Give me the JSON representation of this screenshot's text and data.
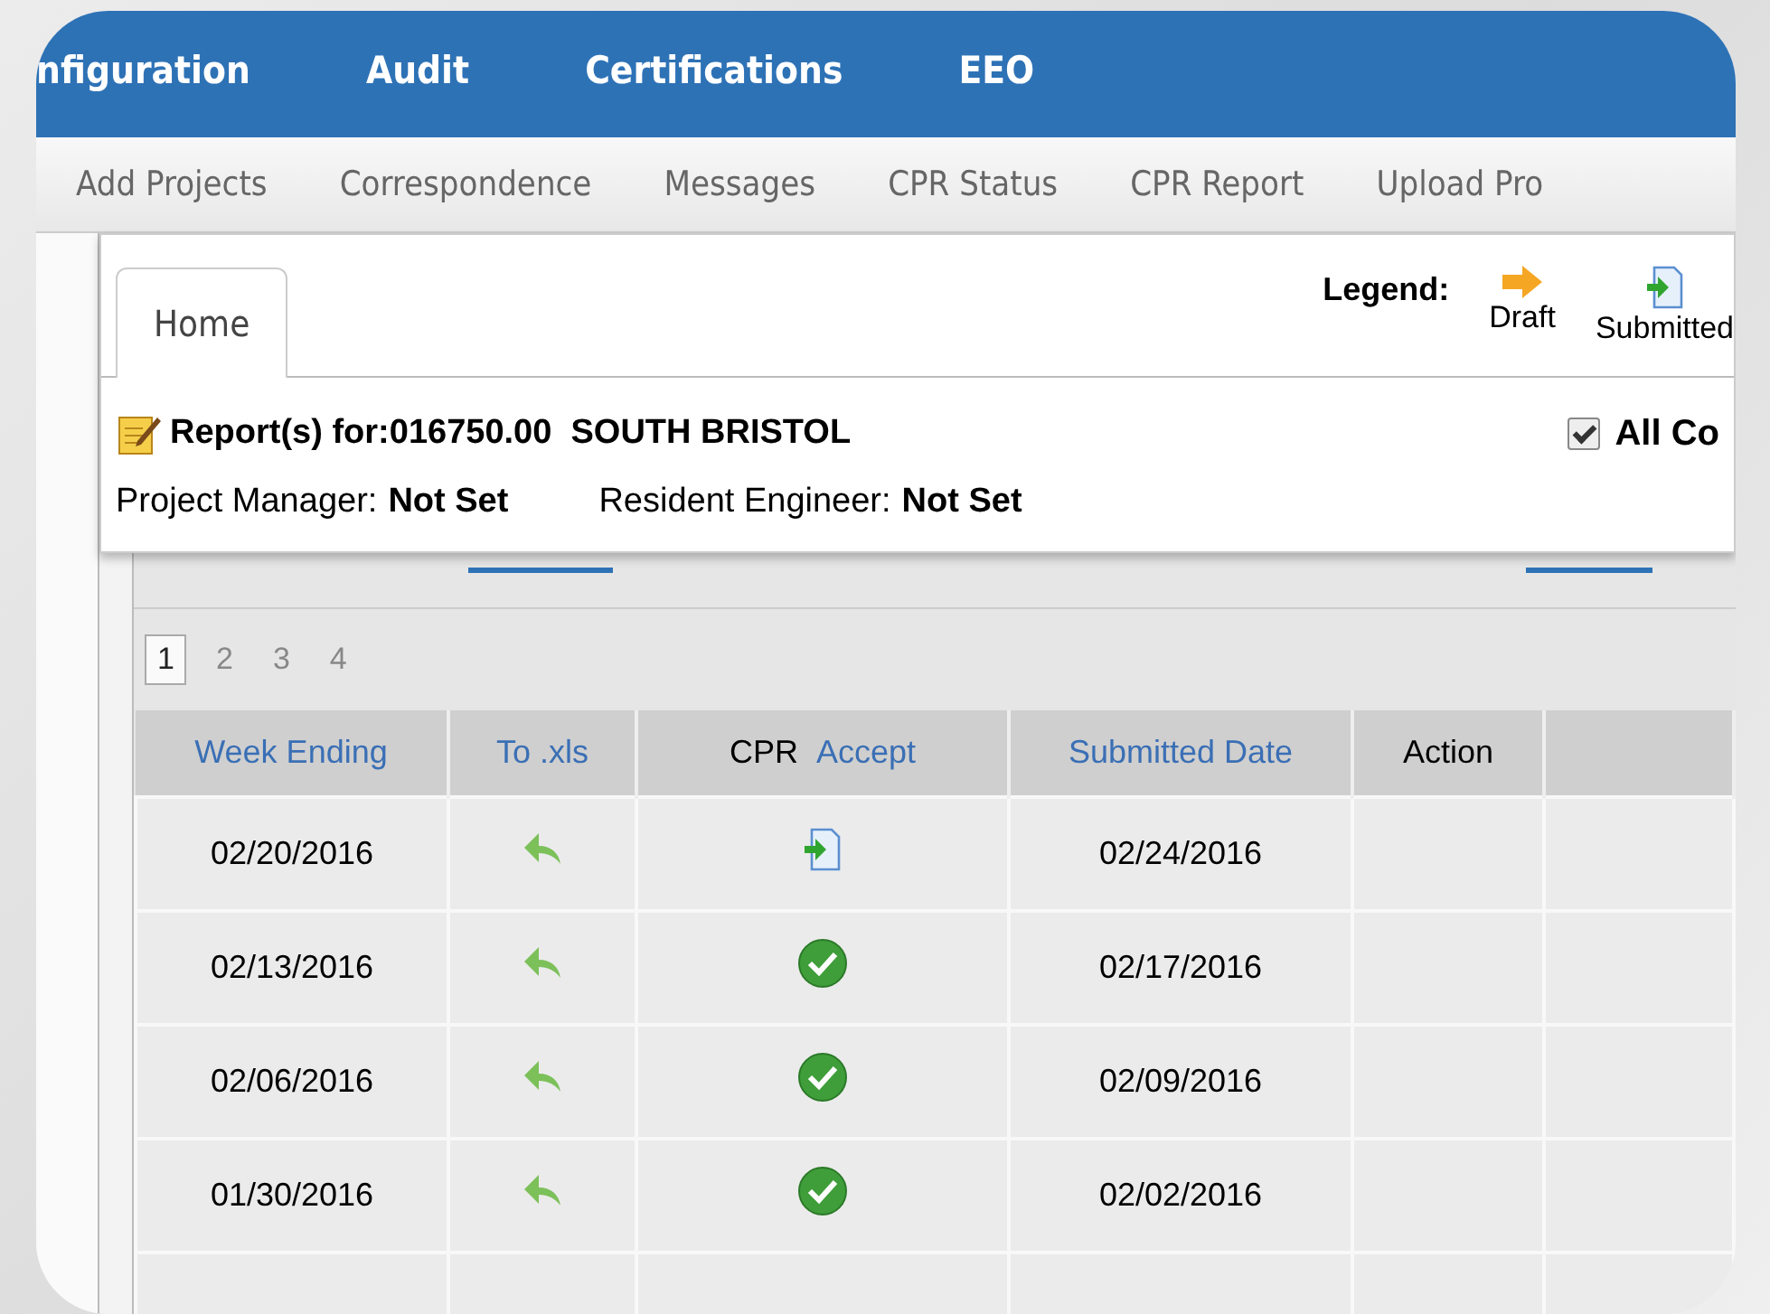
{
  "top_nav": [
    "nfiguration",
    "Audit",
    "Certifications",
    "EEO"
  ],
  "sub_nav": [
    "Add Projects",
    "Correspondence",
    "Messages",
    "CPR Status",
    "CPR Report",
    "Upload Pro"
  ],
  "tabs": [
    {
      "label": "Home",
      "selected": true
    }
  ],
  "legend": {
    "label": "Legend:",
    "items": [
      {
        "label": "Draft",
        "kind": "draft"
      },
      {
        "label": "Submitted",
        "kind": "submitted"
      }
    ]
  },
  "report": {
    "title": "Report(s) for:016750.00  SOUTH BRISTOL",
    "all_checkbox": {
      "label": "All Co",
      "checked": true
    }
  },
  "people": [
    {
      "label": "Project Manager:",
      "value": "Not Set"
    },
    {
      "label": "Resident Engineer:",
      "value": "Not Set"
    }
  ],
  "pagination": [
    {
      "label": "1",
      "selected": true
    },
    {
      "label": "2",
      "selected": false
    },
    {
      "label": "3",
      "selected": false
    },
    {
      "label": "4",
      "selected": false
    }
  ],
  "table": {
    "columns": [
      {
        "label": "Week Ending",
        "kind": "link"
      },
      {
        "label": "To .xls",
        "kind": "link"
      },
      {
        "label": "CPR",
        "kind": "split",
        "link": "Accept"
      },
      {
        "label": "Submitted Date",
        "kind": "link"
      },
      {
        "label": "Action",
        "kind": "plain"
      }
    ],
    "rows": [
      {
        "week_ending": "02/20/2016",
        "kind": "submitted",
        "submitted_date": "02/24/2016"
      },
      {
        "week_ending": "02/13/2016",
        "kind": "accepted",
        "submitted_date": "02/17/2016"
      },
      {
        "week_ending": "02/06/2016",
        "kind": "accepted",
        "submitted_date": "02/09/2016"
      },
      {
        "week_ending": "01/30/2016",
        "kind": "accepted",
        "submitted_date": "02/02/2016"
      }
    ]
  }
}
